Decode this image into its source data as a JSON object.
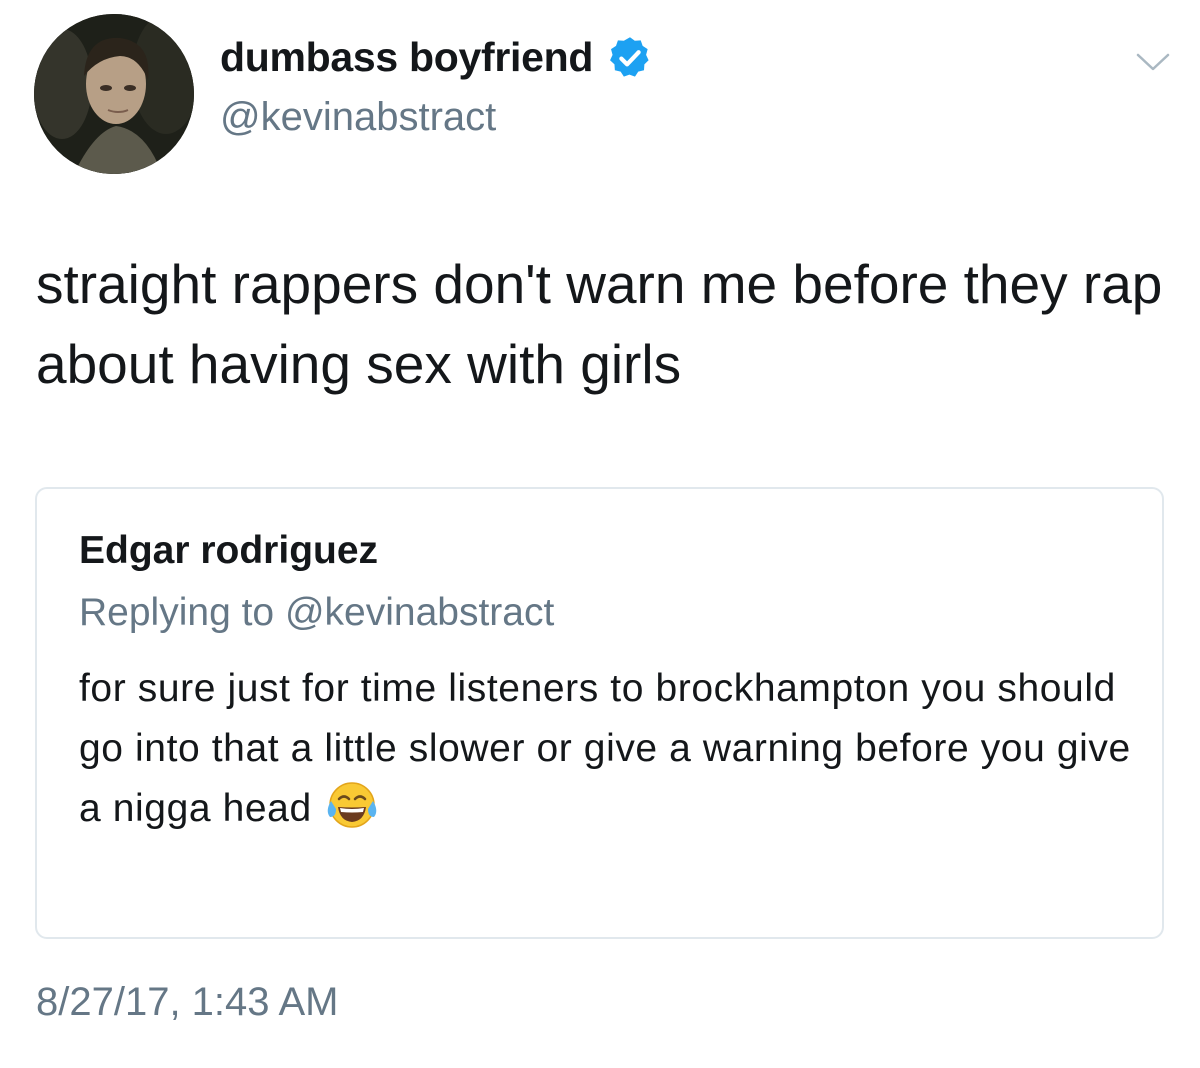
{
  "tweet": {
    "display_name": "dumbass boyfriend",
    "handle": "@kevinabstract",
    "verified": true,
    "text": "straight rappers don't warn me before they rap about having sex with girls",
    "timestamp": "8/27/17, 1:43 AM"
  },
  "quoted_tweet": {
    "display_name": "Edgar rodriguez",
    "replying_to": "Replying to @kevinabstract",
    "text": "for sure just for time listeners to brockhampton you should go into that a little slower or give a warning before you give a nigga head",
    "emoji": "face-with-tears-of-joy-icon"
  },
  "colors": {
    "primary_text": "#14171a",
    "secondary_text": "#657786",
    "verified_blue": "#1da1f2",
    "border": "#e1e8ed"
  },
  "icons": {
    "verified": "verified-badge-icon",
    "menu": "chevron-down-icon"
  }
}
